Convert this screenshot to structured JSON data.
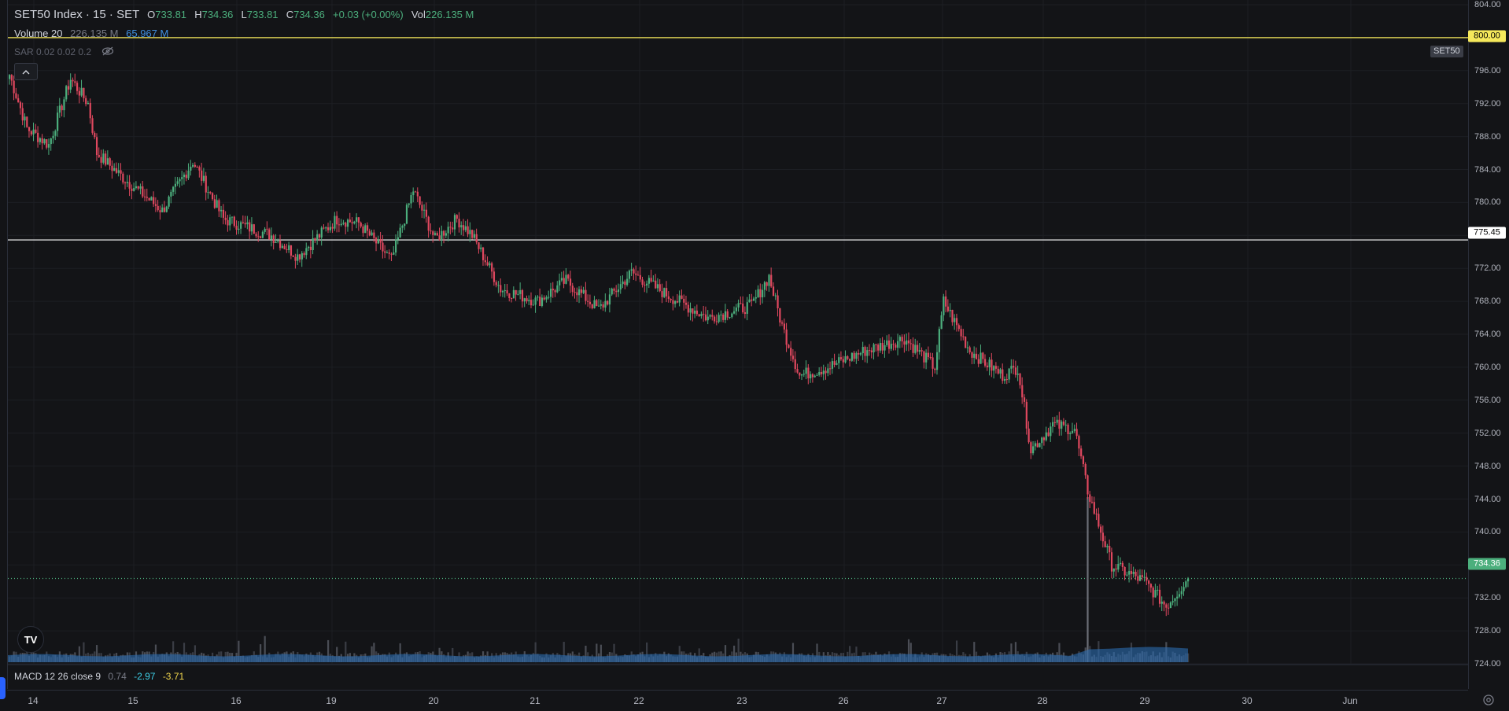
{
  "legend": {
    "symbol": "SET50 Index · 15 · SET",
    "o_label": "O",
    "o_value": "733.81",
    "h_label": "H",
    "h_value": "734.36",
    "l_label": "L",
    "l_value": "733.81",
    "c_label": "C",
    "c_value": "734.36",
    "change": "+0.03 (+0.00%)",
    "vol_label": "Vol",
    "vol_value": "226.135 M"
  },
  "volume_legend": {
    "label": "Volume 20",
    "value": "226.135 M",
    "ma": "65.967 M"
  },
  "sar_legend": {
    "label": "SAR 0.02 0.02 0.2"
  },
  "macd_legend": {
    "label": "MACD 12 26 close 9",
    "v1": "0.74",
    "v2": "-2.97",
    "v3": "-3.71"
  },
  "logo": {
    "text": "TV"
  },
  "price_axis": {
    "ticks": [
      "804.00",
      "800.00",
      "796.00",
      "792.00",
      "788.00",
      "784.00",
      "780.00",
      "776.00",
      "772.00",
      "768.00",
      "764.00",
      "760.00",
      "756.00",
      "752.00",
      "748.00",
      "744.00",
      "740.00",
      "736.00",
      "732.00",
      "728.00",
      "724.00"
    ],
    "label_800": "800.00",
    "label_775": "775.45",
    "label_last": "734.36",
    "tag": "SET50"
  },
  "time_axis": {
    "labels": [
      "14",
      "15",
      "16",
      "19",
      "20",
      "21",
      "22",
      "23",
      "26",
      "27",
      "28",
      "29",
      "30",
      "Jun"
    ]
  },
  "icons": {
    "eye": "eye-off-icon",
    "collapse": "chevron-up-icon",
    "settings": "gear-icon"
  },
  "colors": {
    "up": "#4caf7d",
    "down": "#e0485f",
    "volume": "#2b6cb0",
    "hline_yellow": "#f5e85b",
    "hline_white": "#ffffff"
  },
  "chart_data": {
    "type": "candlestick",
    "ylim": [
      722,
      805
    ],
    "keypoints": [
      [
        0,
        795.5
      ],
      [
        8,
        789
      ],
      [
        18,
        787
      ],
      [
        28,
        795
      ],
      [
        36,
        792
      ],
      [
        40,
        786
      ],
      [
        52,
        783
      ],
      [
        70,
        779
      ],
      [
        84,
        785
      ],
      [
        98,
        778
      ],
      [
        120,
        776
      ],
      [
        132,
        773.5
      ],
      [
        150,
        778
      ],
      [
        160,
        777.5
      ],
      [
        175,
        773
      ],
      [
        185,
        781.5
      ],
      [
        195,
        775.5
      ],
      [
        205,
        778
      ],
      [
        212,
        776
      ],
      [
        225,
        769.5
      ],
      [
        242,
        768
      ],
      [
        255,
        770.5
      ],
      [
        270,
        767
      ],
      [
        285,
        771.5
      ],
      [
        300,
        769
      ],
      [
        320,
        766
      ],
      [
        340,
        767.5
      ],
      [
        348,
        771
      ],
      [
        354,
        765
      ],
      [
        362,
        759
      ],
      [
        375,
        760
      ],
      [
        392,
        762
      ],
      [
        410,
        763.5
      ],
      [
        424,
        760
      ],
      [
        428,
        768
      ],
      [
        440,
        762
      ],
      [
        455,
        759
      ],
      [
        462,
        760
      ],
      [
        468,
        750
      ],
      [
        478,
        753
      ],
      [
        488,
        752.5
      ],
      [
        494,
        745
      ],
      [
        505,
        736
      ],
      [
        520,
        734
      ],
      [
        530,
        731
      ],
      [
        540,
        734.36
      ]
    ],
    "volume_spike_index": 494,
    "last_price": 734.36
  }
}
